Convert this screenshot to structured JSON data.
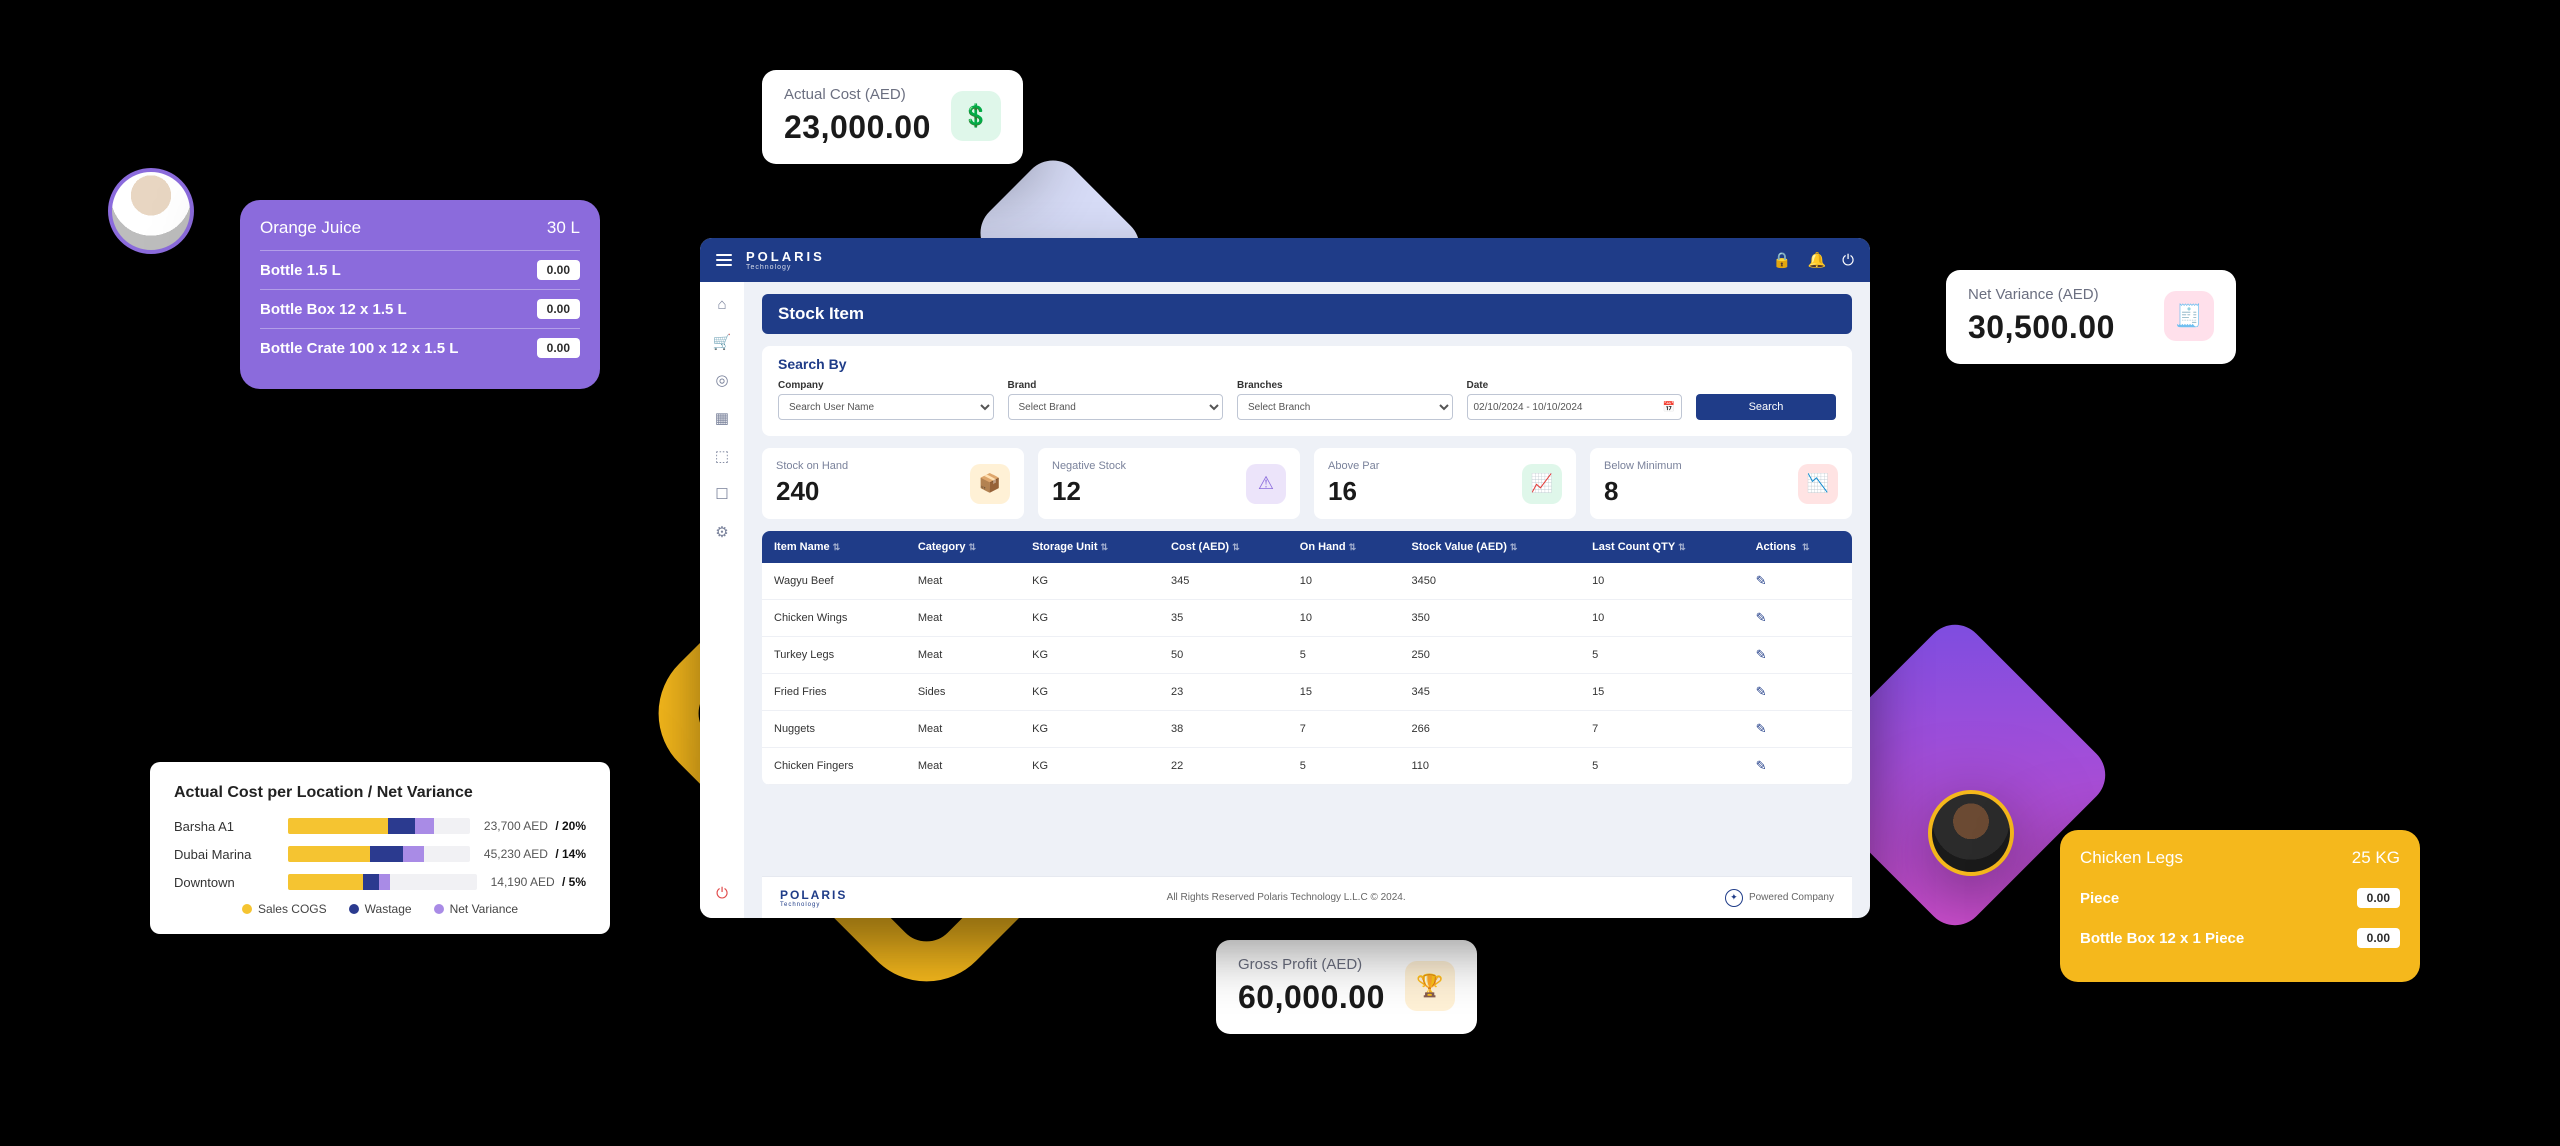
{
  "brand": {
    "name": "POLARIS",
    "sub": "Technology"
  },
  "stat_actual_cost": {
    "label": "Actual Cost (AED)",
    "value": "23,000.00"
  },
  "stat_net_variance": {
    "label": "Net Variance (AED)",
    "value": "30,500.00"
  },
  "stat_gross_profit": {
    "label": "Gross Profit (AED)",
    "value": "60,000.00"
  },
  "purple": {
    "title": "Orange Juice",
    "qty": "30 L",
    "rows": [
      {
        "name": "Bottle 1.5 L",
        "val": "0.00"
      },
      {
        "name": "Bottle Box 12 x 1.5 L",
        "val": "0.00"
      },
      {
        "name": "Bottle Crate 100 x 12 x 1.5 L",
        "val": "0.00"
      }
    ]
  },
  "amber": {
    "title": "Chicken Legs",
    "qty": "25 KG",
    "rows": [
      {
        "name": "Piece",
        "val": "0.00"
      },
      {
        "name": "Bottle Box 12 x 1 Piece",
        "val": "0.00"
      }
    ]
  },
  "barcard": {
    "title": "Actual Cost per Location / Net Variance",
    "rows": [
      {
        "loc": "Barsha A1",
        "cost": "23,700 AED",
        "pct": "20%",
        "s1": 55,
        "s2": 15,
        "s3": 10
      },
      {
        "loc": "Dubai Marina",
        "cost": "45,230 AED",
        "pct": "14%",
        "s1": 45,
        "s2": 18,
        "s3": 12
      },
      {
        "loc": "Downtown",
        "cost": "14,190 AED",
        "pct": "5%",
        "s1": 40,
        "s2": 8,
        "s3": 6
      }
    ],
    "legend": {
      "a": "Sales COGS",
      "b": "Wastage",
      "c": "Net Variance"
    }
  },
  "app": {
    "title": "Stock Item",
    "search_label": "Search By",
    "filters": {
      "company": {
        "label": "Company",
        "placeholder": "Search User Name"
      },
      "brand": {
        "label": "Brand",
        "placeholder": "Select Brand"
      },
      "branches": {
        "label": "Branches",
        "placeholder": "Select Branch"
      },
      "date": {
        "label": "Date",
        "value": "02/10/2024 - 10/10/2024"
      }
    },
    "search_btn": "Search",
    "kpis": [
      {
        "label": "Stock on Hand",
        "value": "240"
      },
      {
        "label": "Negative Stock",
        "value": "12"
      },
      {
        "label": "Above Par",
        "value": "16"
      },
      {
        "label": "Below Minimum",
        "value": "8"
      }
    ],
    "columns": [
      "Item Name",
      "Category",
      "Storage Unit",
      "Cost (AED)",
      "On Hand",
      "Stock Value  (AED)",
      "Last Count QTY",
      "Actions"
    ],
    "rows": [
      {
        "name": "Wagyu Beef",
        "cat": "Meat",
        "unit": "KG",
        "cost": "345",
        "on": "10",
        "value": "3450",
        "last": "10"
      },
      {
        "name": "Chicken Wings",
        "cat": "Meat",
        "unit": "KG",
        "cost": "35",
        "on": "10",
        "value": "350",
        "last": "10"
      },
      {
        "name": "Turkey Legs",
        "cat": "Meat",
        "unit": "KG",
        "cost": "50",
        "on": "5",
        "value": "250",
        "last": "5"
      },
      {
        "name": "Fried Fries",
        "cat": "Sides",
        "unit": "KG",
        "cost": "23",
        "on": "15",
        "value": "345",
        "last": "15"
      },
      {
        "name": "Nuggets",
        "cat": "Meat",
        "unit": "KG",
        "cost": "38",
        "on": "7",
        "value": "266",
        "last": "7"
      },
      {
        "name": "Chicken Fingers",
        "cat": "Meat",
        "unit": "KG",
        "cost": "22",
        "on": "5",
        "value": "110",
        "last": "5"
      }
    ],
    "footer": {
      "copyright": "All Rights Reserved Polaris Technology L.L.C © 2024.",
      "powered": "Powered Company"
    }
  },
  "chart_data": {
    "type": "bar",
    "title": "Actual Cost per Location / Net Variance",
    "categories": [
      "Barsha A1",
      "Dubai Marina",
      "Downtown"
    ],
    "series": [
      {
        "name": "Sales COGS",
        "values": [
          55,
          45,
          40
        ]
      },
      {
        "name": "Wastage",
        "values": [
          15,
          18,
          8
        ]
      },
      {
        "name": "Net Variance",
        "values": [
          10,
          12,
          6
        ]
      }
    ],
    "value_labels": [
      {
        "cost": "23,700 AED",
        "pct": "20%"
      },
      {
        "cost": "45,230 AED",
        "pct": "14%"
      },
      {
        "cost": "14,190 AED",
        "pct": "5%"
      }
    ],
    "xlabel": "",
    "ylabel": ""
  }
}
